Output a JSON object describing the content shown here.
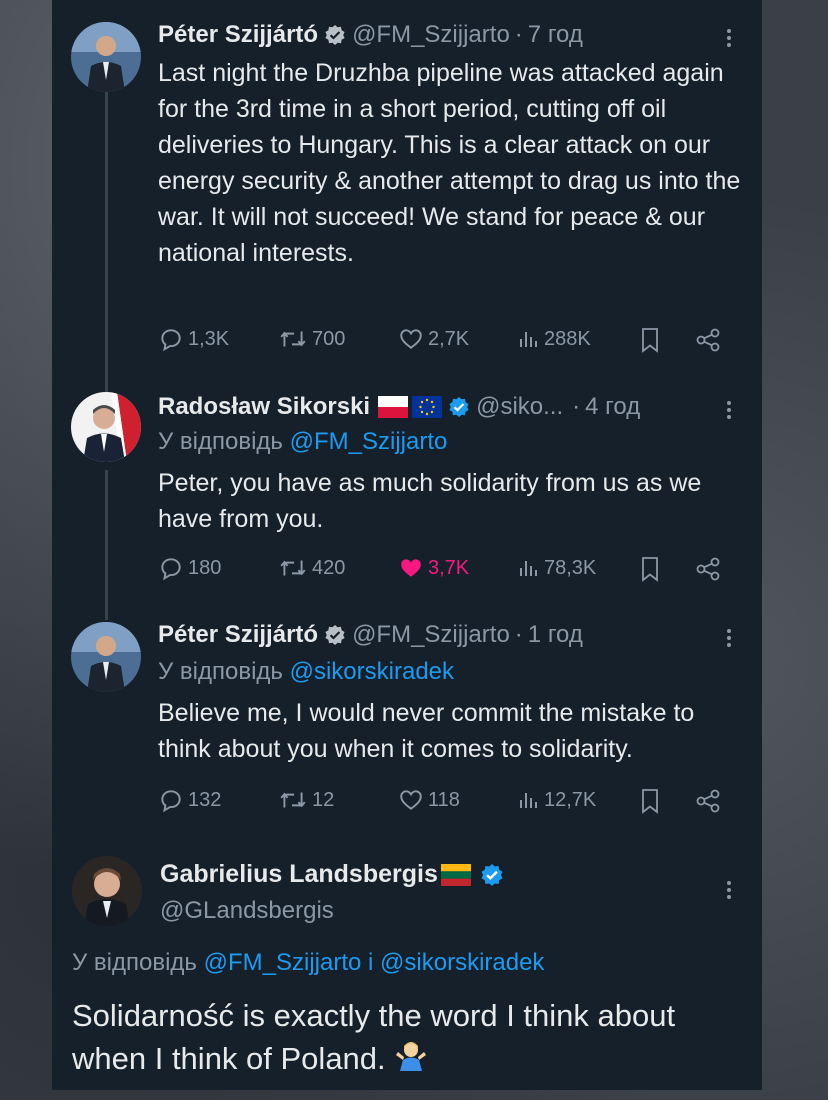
{
  "colors": {
    "accent": "#1d9bf0",
    "like": "#f91880",
    "muted": "#8b98a5",
    "background": "#15202b"
  },
  "tweets": [
    {
      "name": "Péter Szijjártó",
      "handle": "@FM_Szijjarto",
      "dot": "·",
      "time": "7 год",
      "text": "Last night the Druzhba pipeline was attacked again for the 3rd time in a short period, cutting off oil deliveries to Hungary. This is a clear attack on our energy security & another attempt to drag us into the war. It will not succeed! We stand for peace & our national interests.",
      "replies": "1,3K",
      "reposts": "700",
      "likes": "2,7K",
      "views": "288K"
    },
    {
      "name": "Radosław Sikorski",
      "handle": "@siko...",
      "dot": "·",
      "time": "4 год",
      "reply_prefix": "У відповідь",
      "reply_to": "@FM_Szijjarto",
      "text": "Peter, you have as much solidarity from us as we have from you.",
      "replies": "180",
      "reposts": "420",
      "likes": "3,7K",
      "views": "78,3K"
    },
    {
      "name": "Péter Szijjártó",
      "handle": "@FM_Szijjarto",
      "dot": "·",
      "time": "1 год",
      "reply_prefix": "У відповідь",
      "reply_to": "@sikorskiradek",
      "text": "Believe me, I would never commit the mistake to think about you when it comes to solidarity.",
      "replies": "132",
      "reposts": "12",
      "likes": "118",
      "views": "12,7K"
    },
    {
      "name": "Gabrielius Landsbergis",
      "handle": "@GLandsbergis",
      "reply_prefix": "У відповідь",
      "reply_to_1": "@FM_Szijjarto",
      "reply_joiner": "і",
      "reply_to_2": "@sikorskiradek",
      "text": "Solidarność is exactly the word I think about when I think of Poland.",
      "emoji": "person-shrugging"
    }
  ]
}
